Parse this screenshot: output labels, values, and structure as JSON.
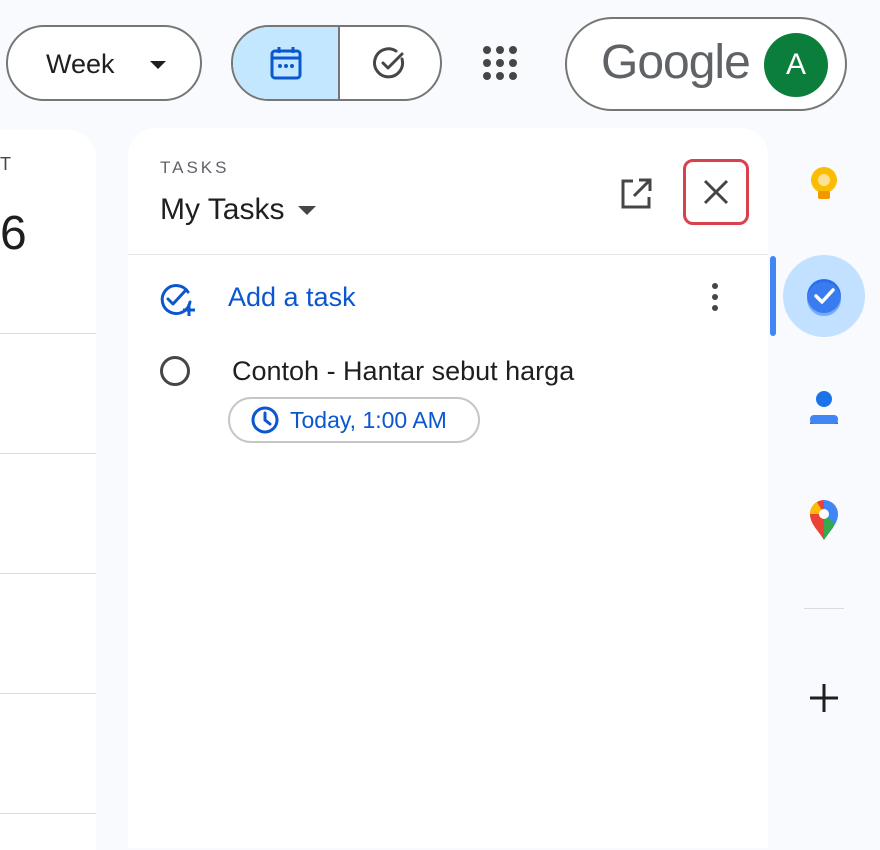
{
  "toolbar": {
    "view_label": "Week",
    "google_logo": "Google",
    "account_initial": "A"
  },
  "calendar": {
    "day_abbr": "T",
    "day_number": "6"
  },
  "tasks_panel": {
    "section_label": "TASKS",
    "list_name": "My Tasks",
    "add_task_label": "Add a task",
    "tasks": [
      {
        "title": "Contoh - Hantar sebut harga",
        "due": "Today, 1:00 AM",
        "completed": false
      }
    ]
  },
  "side_rail": {
    "items": [
      "keep-icon",
      "tasks-icon",
      "contacts-icon",
      "maps-icon",
      "add-icon"
    ]
  },
  "colors": {
    "accent": "#0b57d0",
    "selected_bg": "#c2e7ff",
    "avatar_bg": "#0b7e3c",
    "highlight_border": "#d9414b"
  }
}
